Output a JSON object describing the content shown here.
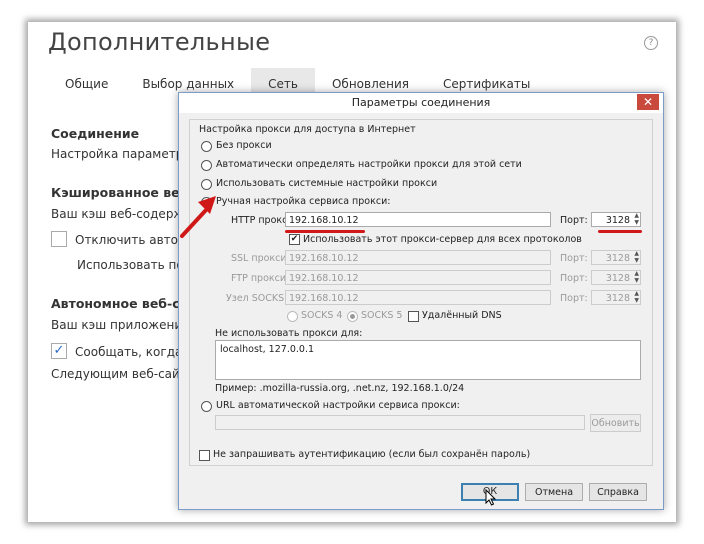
{
  "background": {
    "title": "Дополнительные",
    "help_glyph": "?",
    "tabs": [
      {
        "label": "Общие"
      },
      {
        "label": "Выбор данных"
      },
      {
        "label": "Сеть"
      },
      {
        "label": "Обновления"
      },
      {
        "label": "Сертификаты"
      }
    ],
    "active_tab": "Сеть",
    "content": {
      "connection_heading": "Соединение",
      "connection_text": "Настройка параметров",
      "cache_heading": "Кэшированное веб-с",
      "cache_text": "Ваш кэш веб-содержим",
      "disable_auto": "Отключить автомат",
      "use_under": "Использовать под",
      "offline_heading": "Автономное веб-соде",
      "offline_text": "Ваш кэш приложения се",
      "notify": "Сообщать, когда ве",
      "sites": "Следующим веб-сайтам"
    }
  },
  "dialog": {
    "title": "Параметры соединения",
    "close_glyph": "✕",
    "group_label": "Настройка прокси для доступа в Интернет",
    "options": {
      "no_proxy": "Без прокси",
      "auto_detect": "Автоматически определять настройки прокси для этой сети",
      "system": "Использовать системные настройки прокси",
      "manual": "Ручная настройка сервиса прокси:",
      "auto_url": "URL автоматической настройки сервиса прокси:"
    },
    "selected_option": "manual",
    "http_label": "HTTP прокси:",
    "http_value": "192.168.10.12",
    "port_label": "Порт:",
    "http_port": "3128",
    "use_all_label": "Использовать этот прокси-сервер для всех протоколов",
    "use_all_checked": true,
    "ssl_label": "SSL прокси:",
    "ssl_value": "192.168.10.12",
    "ssl_port": "3128",
    "ftp_label": "FTP прокси:",
    "ftp_value": "192.168.10.12",
    "ftp_port": "3128",
    "socks_label": "Узел SOCKS:",
    "socks_value": "192.168.10.12",
    "socks_port": "3128",
    "socks4": "SOCKS 4",
    "socks5": "SOCKS 5",
    "remote_dns": "Удалённый DNS",
    "no_proxy_label": "Не использовать прокси для:",
    "no_proxy_value": "localhost, 127.0.0.1",
    "example": "Пример: .mozilla-russia.org, .net.nz, 192.168.1.0/24",
    "auto_url_value": "",
    "reload_btn": "Обновить",
    "no_auth_label": "Не запрашивать аутентификацию (если был сохранён пароль)",
    "ok_btn": "ОК",
    "cancel_btn": "Отмена",
    "help_btn": "Справка"
  },
  "colors": {
    "annotation_red": "#d01818",
    "close_red": "#c94a3c",
    "default_button_blue": "#3c7fb1"
  }
}
